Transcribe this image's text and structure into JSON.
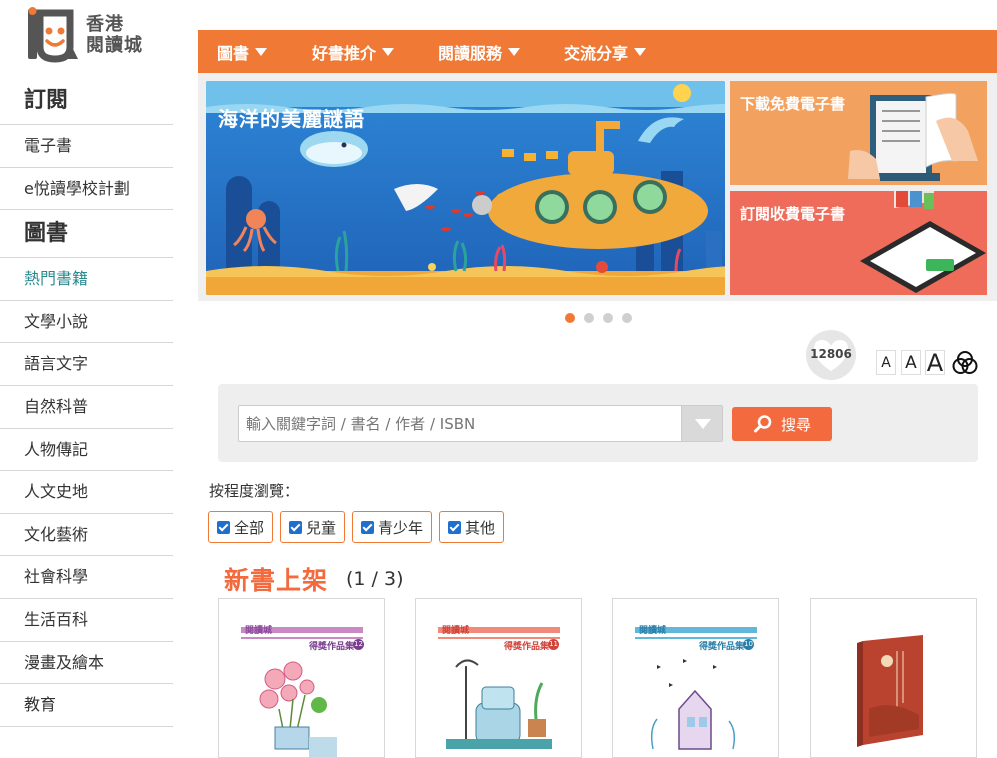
{
  "logo": {
    "line1": "香港",
    "line2": "閱讀城",
    "icon": "reading-city-logo-icon"
  },
  "sidebar": {
    "section1": "訂閱",
    "subscribe_items": [
      {
        "label": "電子書"
      },
      {
        "label": "e悅讀學校計劃"
      }
    ],
    "section2": "圖書",
    "book_items": [
      {
        "label": "熱門書籍"
      },
      {
        "label": "文學小說"
      },
      {
        "label": "語言文字"
      },
      {
        "label": "自然科普"
      },
      {
        "label": "人物傳記"
      },
      {
        "label": "人文史地"
      },
      {
        "label": "文化藝術"
      },
      {
        "label": "社會科學"
      },
      {
        "label": "生活百科"
      },
      {
        "label": "漫畫及繪本"
      },
      {
        "label": "教育"
      }
    ],
    "active_color": "#2a8a8f"
  },
  "nav": {
    "items": [
      {
        "label": "圖書"
      },
      {
        "label": "好書推介"
      },
      {
        "label": "閱讀服務"
      },
      {
        "label": "交流分享"
      }
    ],
    "color": "#f07a35"
  },
  "banner": {
    "main_title": "海洋的美麗謎語",
    "promo1": "下載免費電子書",
    "promo2": "訂閱收費電子書",
    "slides_count": 4,
    "active_slide": 1
  },
  "counter": {
    "value": "12806"
  },
  "font_sizes": [
    "A",
    "A",
    "A"
  ],
  "search": {
    "placeholder": "輸入關鍵字詞 / 書名 / 作者 / ISBN",
    "button": "搜尋"
  },
  "browse": {
    "label": "按程度瀏覽：",
    "filters": [
      {
        "label": "全部",
        "checked": true
      },
      {
        "label": "兒童",
        "checked": true
      },
      {
        "label": "青少年",
        "checked": true
      },
      {
        "label": "其他",
        "checked": true
      }
    ]
  },
  "new_books": {
    "title": "新書上架",
    "page": "(1 / 3)",
    "books": [
      {
        "series": "得獎作品集",
        "volume": "12"
      },
      {
        "series": "得獎作品集",
        "volume": "11"
      },
      {
        "series": "得獎作品集",
        "volume": "10"
      },
      {
        "series": "",
        "volume": ""
      }
    ]
  },
  "colors": {
    "accent": "#f07a35",
    "button": "#f26a3d",
    "teal": "#2a8a8f"
  }
}
